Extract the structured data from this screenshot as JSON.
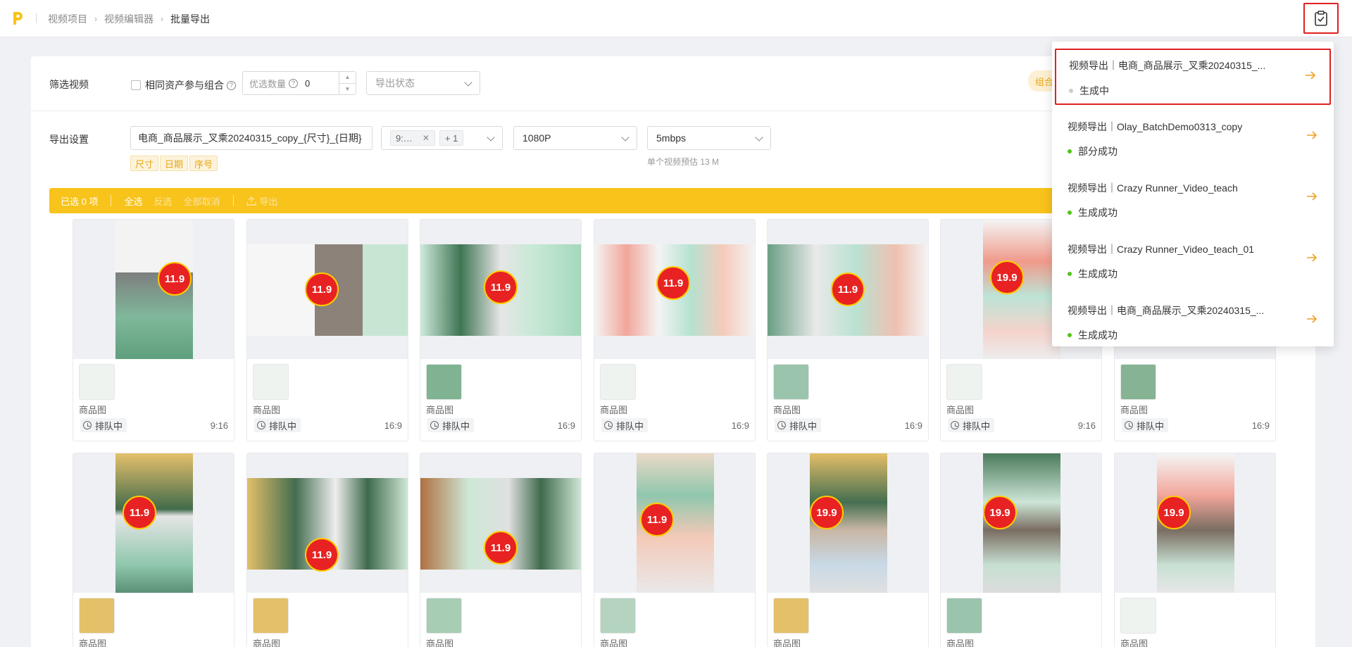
{
  "header": {
    "breadcrumb": [
      "视频项目",
      "视频编辑器",
      "批量导出"
    ],
    "task_icon": "clipboard-check-icon"
  },
  "filter": {
    "label": "筛选视频",
    "same_asset_checkbox": "相同资产参与组合",
    "preferred_count_placeholder": "优选数量",
    "preferred_count_value": "0",
    "export_status_placeholder": "导出状态",
    "combo_badge": "组合"
  },
  "export_settings": {
    "label": "导出设置",
    "filename": "电商_商品展示_叉乘20240315_copy_{尺寸}_{日期}",
    "tags": [
      "尺寸",
      "日期",
      "序号"
    ],
    "ratio_chip": "9:…",
    "ratio_more": "+ 1",
    "resolution": "1080P",
    "bitrate": "5mbps",
    "size_hint": "单个视频预估 13 M"
  },
  "action_bar": {
    "selected": "已选 0 项",
    "select_all": "全选",
    "invert": "反选",
    "cancel_all": "全部取消",
    "export": "导出"
  },
  "cards_row1": [
    {
      "kind": "商品图",
      "status": "排队中",
      "ratio": "9:16",
      "price": "11.9"
    },
    {
      "kind": "商品图",
      "status": "排队中",
      "ratio": "16:9",
      "price": "11.9"
    },
    {
      "kind": "商品图",
      "status": "排队中",
      "ratio": "16:9",
      "price": "11.9"
    },
    {
      "kind": "商品图",
      "status": "排队中",
      "ratio": "16:9",
      "price": "11.9"
    },
    {
      "kind": "商品图",
      "status": "排队中",
      "ratio": "16:9",
      "price": "11.9"
    },
    {
      "kind": "商品图",
      "status": "排队中",
      "ratio": "9:16",
      "price": "19.9"
    },
    {
      "kind": "商品图",
      "status": "排队中",
      "ratio": "16:9",
      "price": ""
    }
  ],
  "cards_row2": [
    {
      "kind": "商品图",
      "price": "11.9"
    },
    {
      "kind": "商品图",
      "price": "11.9"
    },
    {
      "kind": "商品图",
      "price": "11.9"
    },
    {
      "kind": "商品图",
      "price": "11.9"
    },
    {
      "kind": "商品图",
      "price": "19.9"
    },
    {
      "kind": "商品图",
      "price": "19.9"
    },
    {
      "kind": "商品图",
      "price": "19.9"
    }
  ],
  "tasks": [
    {
      "title": "视频导出｜电商_商品展示_叉乘20240315_...",
      "status": "生成中",
      "status_color": "#cccccc"
    },
    {
      "title": "视频导出｜Olay_BatchDemo0313_copy",
      "status": "部分成功",
      "status_color": "#52c41a"
    },
    {
      "title": "视频导出｜Crazy Runner_Video_teach",
      "status": "生成成功",
      "status_color": "#52c41a"
    },
    {
      "title": "视频导出｜Crazy Runner_Video_teach_01",
      "status": "生成成功",
      "status_color": "#52c41a"
    },
    {
      "title": "视频导出｜电商_商品展示_叉乘20240315_...",
      "status": "生成成功",
      "status_color": "#52c41a"
    }
  ],
  "colors": {
    "accent": "#f8c31a",
    "highlight": "#e02020",
    "arrow": "#f0a020"
  }
}
